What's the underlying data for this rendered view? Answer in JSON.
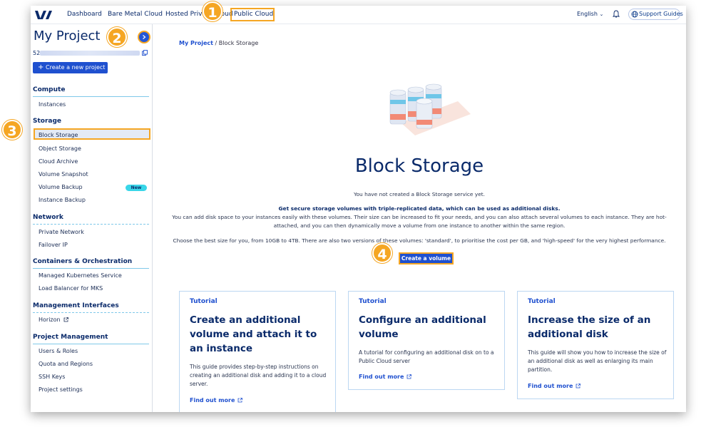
{
  "nav": {
    "items": [
      "Dashboard",
      "Bare Metal Cloud",
      "Hosted Private Cloud",
      "Public Cloud"
    ],
    "language": "English",
    "support": "Support Guides"
  },
  "sidebar": {
    "project_title": "My Project",
    "project_id_prefix": "52",
    "create_project": "Create a new project",
    "sections": [
      {
        "title": "Compute",
        "items": [
          "Instances"
        ]
      },
      {
        "title": "Storage",
        "items": [
          "Block Storage",
          "Object Storage",
          "Cloud Archive",
          "Volume Snapshot",
          "Volume Backup",
          "Instance Backup"
        ]
      },
      {
        "title": "Network",
        "items": [
          "Private Network",
          "Failover IP"
        ]
      },
      {
        "title": "Containers & Orchestration",
        "items": [
          "Managed Kubernetes Service",
          "Load Balancer for MKS"
        ]
      },
      {
        "title": "Management Interfaces",
        "items": [
          "Horizon"
        ]
      },
      {
        "title": "Project Management",
        "items": [
          "Users & Roles",
          "Quota and Regions",
          "SSH Keys",
          "Project settings"
        ]
      }
    ],
    "new_badge": "New"
  },
  "main": {
    "breadcrumb_root": "My Project",
    "breadcrumb_sep": "/",
    "breadcrumb_current": "Block Storage",
    "title": "Block Storage",
    "empty_text": "You have not created a Block Storage service yet.",
    "intro_bold": "Get secure storage volumes with triple-replicated data, which can be used as additional disks.",
    "intro_line1": "You can add disk space to your instances easily with these volumes. Their size can be increased to fit your needs, and you can also attach several volumes to each instance. They are hot-",
    "intro_line2": "attached, and you can then dynamically move a volume from one instance to another within the same region.",
    "intro_line3": "Choose the best size for you, from 10GB to 4TB. There are also two versions of these volumes: 'standard', to prioritise the cost per GB, and 'high-speed' for the very highest performance.",
    "create_volume": "Create a volume",
    "cards": [
      {
        "tag": "Tutorial",
        "title": "Create an additional volume and attach it to an instance",
        "desc": "This guide provides step-by-step instructions on creating an additional disk and adding it to a cloud server.",
        "link": "Find out more"
      },
      {
        "tag": "Tutorial",
        "title": "Configure an additional volume",
        "desc": "A tutorial for configuring an additional disk on to a Public Cloud server",
        "link": "Find out more"
      },
      {
        "tag": "Tutorial",
        "title": "Increase the size of an additional disk",
        "desc": "This guide will show you how to increase the size of an additional disk as well as enlarging its main partition.",
        "link": "Find out more"
      }
    ]
  },
  "steps": [
    "1",
    "2",
    "3",
    "4"
  ],
  "colors": {
    "accent": "#1f50cf",
    "highlight": "#f5a623",
    "badge": "#39d6e8",
    "navy": "#0a2a6a"
  }
}
